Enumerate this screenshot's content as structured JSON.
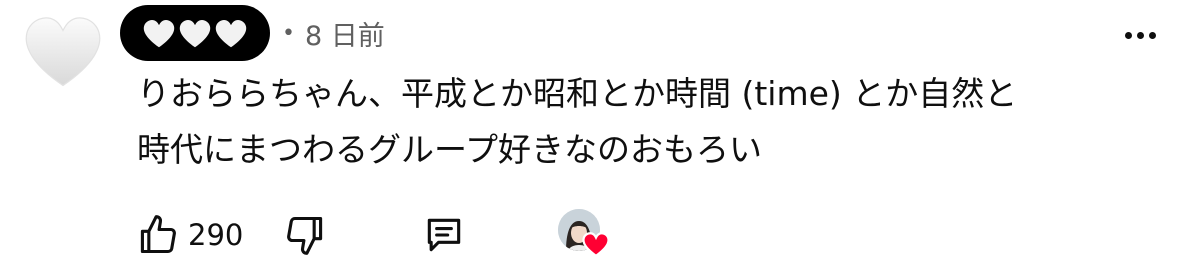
{
  "comment": {
    "author": {
      "avatar_icon": "white-heart-icon",
      "name_icons": [
        "white-heart-icon",
        "white-heart-icon",
        "white-heart-icon"
      ]
    },
    "separator": "•",
    "timestamp": "8 日前",
    "text_lines": [
      "りおららちゃん、平成とか昭和とか時間 (time) とか自然と",
      "時代にまつわるグループ好きなのおもろい"
    ],
    "like_count": "290",
    "creator_heart": {
      "avatar_icon": "creator-avatar-icon",
      "badge_icon": "red-heart-icon",
      "badge_color": "#ff0033"
    }
  },
  "icons": {
    "like": "thumbs-up-icon",
    "dislike": "thumbs-down-icon",
    "reply": "comment-icon",
    "more": "more-vertical-icon"
  }
}
